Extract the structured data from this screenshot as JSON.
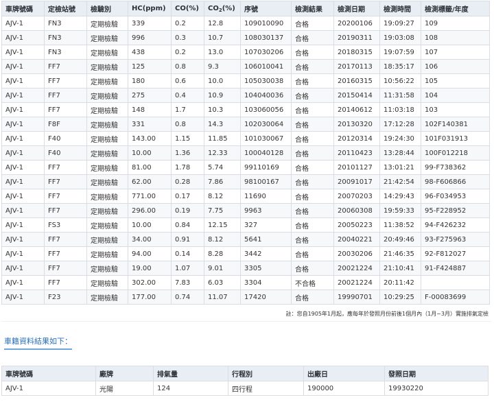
{
  "inspection": {
    "headers": {
      "plate": "車牌號碼",
      "station": "定檢站號",
      "type": "檢驗別",
      "hc": "HC(ppm)",
      "co": "CO(%)",
      "co2_prefix": "CO",
      "co2_sub": "2",
      "co2_suffix": "(%)",
      "serial": "序號",
      "result": "檢測結果",
      "date": "檢測日期",
      "time": "檢測時間",
      "label": "檢測標籤/年度"
    },
    "rows": [
      {
        "plate": "AJV-1",
        "station": "FN3",
        "type": "定期檢驗",
        "hc": "339",
        "co": "0.2",
        "co2": "12.8",
        "serial": "109010090",
        "result": "合格",
        "date": "20200106",
        "time": "19:09:27",
        "label": "109"
      },
      {
        "plate": "AJV-1",
        "station": "FN3",
        "type": "定期檢驗",
        "hc": "996",
        "co": "0.3",
        "co2": "10.7",
        "serial": "108030137",
        "result": "合格",
        "date": "20190311",
        "time": "19:03:08",
        "label": "108"
      },
      {
        "plate": "AJV-1",
        "station": "FN3",
        "type": "定期檢驗",
        "hc": "438",
        "co": "0.2",
        "co2": "13.0",
        "serial": "107030206",
        "result": "合格",
        "date": "20180315",
        "time": "19:07:59",
        "label": "107"
      },
      {
        "plate": "AJV-1",
        "station": "FF7",
        "type": "定期檢驗",
        "hc": "125",
        "co": "0.8",
        "co2": "9.3",
        "serial": "106010041",
        "result": "合格",
        "date": "20170113",
        "time": "18:35:17",
        "label": "106"
      },
      {
        "plate": "AJV-1",
        "station": "FF7",
        "type": "定期檢驗",
        "hc": "180",
        "co": "0.6",
        "co2": "10.0",
        "serial": "105030038",
        "result": "合格",
        "date": "20160315",
        "time": "10:56:22",
        "label": "105"
      },
      {
        "plate": "AJV-1",
        "station": "FF7",
        "type": "定期檢驗",
        "hc": "275",
        "co": "0.4",
        "co2": "10.9",
        "serial": "104040036",
        "result": "合格",
        "date": "20150414",
        "time": "11:31:58",
        "label": "104"
      },
      {
        "plate": "AJV-1",
        "station": "FF7",
        "type": "定期檢驗",
        "hc": "148",
        "co": "1.7",
        "co2": "10.3",
        "serial": "103060056",
        "result": "合格",
        "date": "20140612",
        "time": "11:03:18",
        "label": "103"
      },
      {
        "plate": "AJV-1",
        "station": "F8F",
        "type": "定期檢驗",
        "hc": "331",
        "co": "0.8",
        "co2": "14.3",
        "serial": "102030064",
        "result": "合格",
        "date": "20130320",
        "time": "17:12:28",
        "label": "102F140381"
      },
      {
        "plate": "AJV-1",
        "station": "F40",
        "type": "定期檢驗",
        "hc": "143.00",
        "co": "1.15",
        "co2": "11.85",
        "serial": "101030067",
        "result": "合格",
        "date": "20120314",
        "time": "19:24:30",
        "label": "101F031913"
      },
      {
        "plate": "AJV-1",
        "station": "F40",
        "type": "定期檢驗",
        "hc": "10.00",
        "co": "1.36",
        "co2": "12.33",
        "serial": "100040128",
        "result": "合格",
        "date": "20110423",
        "time": "13:28:44",
        "label": "100F012218"
      },
      {
        "plate": "AJV-1",
        "station": "FF7",
        "type": "定期檢驗",
        "hc": "81.00",
        "co": "1.78",
        "co2": "5.74",
        "serial": "99110169",
        "result": "合格",
        "date": "20101127",
        "time": "13:01:21",
        "label": "99-F738362"
      },
      {
        "plate": "AJV-1",
        "station": "FF7",
        "type": "定期檢驗",
        "hc": "62.00",
        "co": "0.28",
        "co2": "7.86",
        "serial": "98100167",
        "result": "合格",
        "date": "20091017",
        "time": "21:42:54",
        "label": "98-F606866"
      },
      {
        "plate": "AJV-1",
        "station": "FF7",
        "type": "定期檢驗",
        "hc": "771.00",
        "co": "0.17",
        "co2": "8.12",
        "serial": "11690",
        "result": "合格",
        "date": "20070203",
        "time": "14:29:43",
        "label": "96-F034953"
      },
      {
        "plate": "AJV-1",
        "station": "FF7",
        "type": "定期檢驗",
        "hc": "296.00",
        "co": "0.19",
        "co2": "7.75",
        "serial": "9963",
        "result": "合格",
        "date": "20060308",
        "time": "19:59:33",
        "label": "95-F228952"
      },
      {
        "plate": "AJV-1",
        "station": "FS3",
        "type": "定期檢驗",
        "hc": "10.00",
        "co": "0.84",
        "co2": "12.15",
        "serial": "327",
        "result": "合格",
        "date": "20050223",
        "time": "11:38:52",
        "label": "94-F426232"
      },
      {
        "plate": "AJV-1",
        "station": "FF7",
        "type": "定期檢驗",
        "hc": "34.00",
        "co": "0.91",
        "co2": "8.12",
        "serial": "5641",
        "result": "合格",
        "date": "20040221",
        "time": "20:49:46",
        "label": "93-F275963"
      },
      {
        "plate": "AJV-1",
        "station": "FF7",
        "type": "定期檢驗",
        "hc": "94.00",
        "co": "0.14",
        "co2": "8.28",
        "serial": "3442",
        "result": "合格",
        "date": "20030206",
        "time": "21:46:35",
        "label": "92-F812027"
      },
      {
        "plate": "AJV-1",
        "station": "FF7",
        "type": "定期檢驗",
        "hc": "19.00",
        "co": "1.07",
        "co2": "9.01",
        "serial": "3305",
        "result": "合格",
        "date": "20021224",
        "time": "21:10:41",
        "label": "91-F424887"
      },
      {
        "plate": "AJV-1",
        "station": "FF7",
        "type": "定期檢驗",
        "hc": "302.00",
        "co": "7.83",
        "co2": "6.03",
        "serial": "3304",
        "result": "不合格",
        "date": "20021224",
        "time": "20:11:42",
        "label": ""
      },
      {
        "plate": "AJV-1",
        "station": "F23",
        "type": "定期檢驗",
        "hc": "177.00",
        "co": "0.74",
        "co2": "11.07",
        "serial": "17420",
        "result": "合格",
        "date": "19990701",
        "time": "10:29:25",
        "label": "F-00083699"
      }
    ],
    "note": "註：您自1905年1月起，應每年於發照月份前後1個月內（1月~3月）實施排氣定檢"
  },
  "vehicle": {
    "title": "車籍資料結果如下：",
    "headers": {
      "plate": "車牌號碼",
      "brand": "廠牌",
      "displacement": "排氣量",
      "stroke": "行程別",
      "manufacture_date": "出廠日",
      "issue_date": "發照日期"
    },
    "row": {
      "plate": "AJV-1",
      "brand": "光陽",
      "displacement": "124",
      "stroke": "四行程",
      "manufacture_date": "190000",
      "issue_date": "19930220"
    }
  }
}
